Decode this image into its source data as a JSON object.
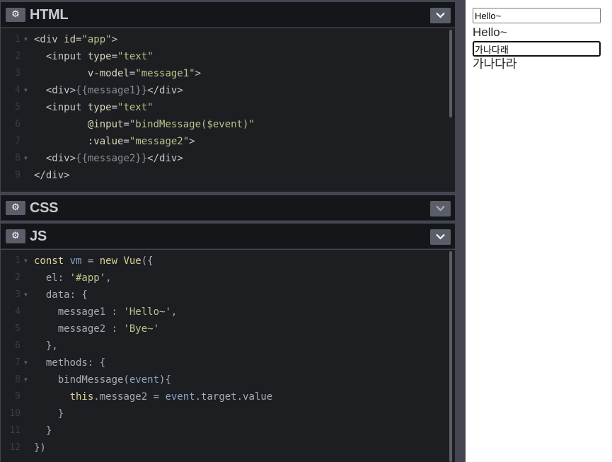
{
  "panels": {
    "html": {
      "title": "HTML",
      "gear_icon": "gear-icon",
      "collapse_icon": "chevron-down-icon"
    },
    "css": {
      "title": "CSS",
      "gear_icon": "gear-icon",
      "collapse_icon": "chevron-down-icon"
    },
    "js": {
      "title": "JS",
      "gear_icon": "gear-icon",
      "collapse_icon": "chevron-down-icon"
    }
  },
  "html_code": [
    {
      "n": "1",
      "fold": true,
      "segs": [
        [
          "t",
          "<div "
        ],
        [
          "at",
          "id"
        ],
        [
          "t",
          "="
        ],
        [
          "s",
          "\"app\""
        ],
        [
          "t",
          ">"
        ]
      ]
    },
    {
      "n": "2",
      "fold": false,
      "segs": [
        [
          "t",
          "  <input "
        ],
        [
          "at",
          "type"
        ],
        [
          "t",
          "="
        ],
        [
          "s",
          "\"text\""
        ]
      ]
    },
    {
      "n": "3",
      "fold": false,
      "segs": [
        [
          "at",
          "         v-model"
        ],
        [
          "t",
          "="
        ],
        [
          "s",
          "\"message1\""
        ],
        [
          "t",
          ">"
        ]
      ]
    },
    {
      "n": "4",
      "fold": true,
      "segs": [
        [
          "t",
          "  <div>"
        ],
        [
          "g",
          "{{message1}}"
        ],
        [
          "t",
          "</div>"
        ]
      ]
    },
    {
      "n": "5",
      "fold": false,
      "segs": [
        [
          "t",
          "  <input "
        ],
        [
          "at",
          "type"
        ],
        [
          "t",
          "="
        ],
        [
          "s",
          "\"text\""
        ]
      ]
    },
    {
      "n": "6",
      "fold": false,
      "segs": [
        [
          "at",
          "         @input"
        ],
        [
          "t",
          "="
        ],
        [
          "s",
          "\"bindMessage($event)\""
        ]
      ]
    },
    {
      "n": "7",
      "fold": false,
      "segs": [
        [
          "at",
          "         :value"
        ],
        [
          "t",
          "="
        ],
        [
          "s",
          "\"message2\""
        ],
        [
          "t",
          ">"
        ]
      ]
    },
    {
      "n": "8",
      "fold": true,
      "segs": [
        [
          "t",
          "  <div>"
        ],
        [
          "g",
          "{{message2}}"
        ],
        [
          "t",
          "</div>"
        ]
      ]
    },
    {
      "n": "9",
      "fold": false,
      "segs": [
        [
          "t",
          "</div>"
        ]
      ]
    }
  ],
  "js_code": [
    {
      "n": "1",
      "fold": true,
      "segs": [
        [
          "k",
          "const "
        ],
        [
          "v",
          "vm"
        ],
        [
          "p",
          " = "
        ],
        [
          "k",
          "new "
        ],
        [
          "k",
          "Vue"
        ],
        [
          "p",
          "({"
        ]
      ]
    },
    {
      "n": "2",
      "fold": false,
      "segs": [
        [
          "p",
          "  el: "
        ],
        [
          "s",
          "'#app'"
        ],
        [
          "p",
          ","
        ]
      ]
    },
    {
      "n": "3",
      "fold": true,
      "segs": [
        [
          "p",
          "  data: {"
        ]
      ]
    },
    {
      "n": "4",
      "fold": false,
      "segs": [
        [
          "p",
          "    message1 : "
        ],
        [
          "s",
          "'Hello~'"
        ],
        [
          "p",
          ","
        ]
      ]
    },
    {
      "n": "5",
      "fold": false,
      "segs": [
        [
          "p",
          "    message2 : "
        ],
        [
          "s",
          "'Bye~'"
        ]
      ]
    },
    {
      "n": "6",
      "fold": false,
      "segs": [
        [
          "p",
          "  },"
        ]
      ]
    },
    {
      "n": "7",
      "fold": true,
      "segs": [
        [
          "p",
          "  methods: {"
        ]
      ]
    },
    {
      "n": "8",
      "fold": true,
      "segs": [
        [
          "p",
          "    bindMessage("
        ],
        [
          "v",
          "event"
        ],
        [
          "p",
          "){"
        ]
      ]
    },
    {
      "n": "9",
      "fold": false,
      "segs": [
        [
          "k",
          "      this"
        ],
        [
          "p",
          ".message2 = "
        ],
        [
          "v",
          "event"
        ],
        [
          "p",
          ".target.value"
        ]
      ]
    },
    {
      "n": "10",
      "fold": false,
      "segs": [
        [
          "p",
          "    }"
        ]
      ]
    },
    {
      "n": "11",
      "fold": false,
      "segs": [
        [
          "p",
          "  }"
        ]
      ]
    },
    {
      "n": "12",
      "fold": false,
      "segs": [
        [
          "p",
          "})"
        ]
      ]
    }
  ],
  "result": {
    "input1_value": "Hello~",
    "text1": "Hello~",
    "input2_value": "가나다래",
    "text2": "가나다라"
  }
}
